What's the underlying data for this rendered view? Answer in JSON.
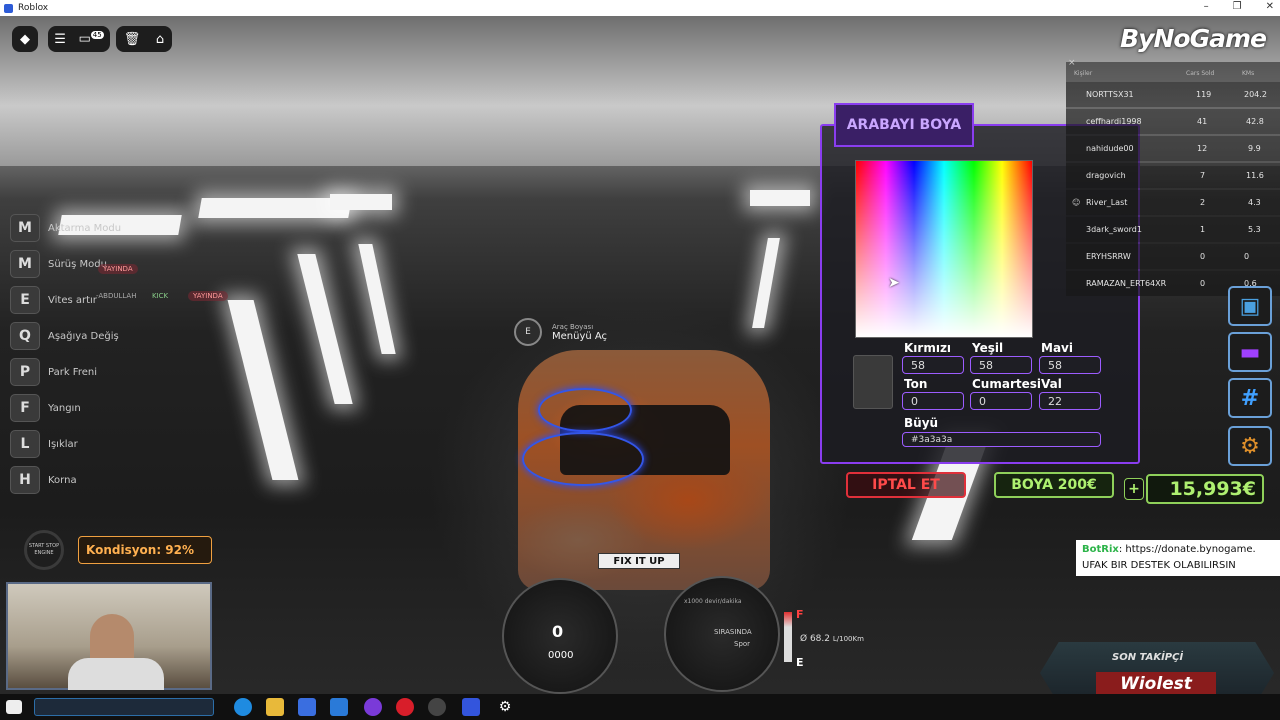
{
  "window": {
    "title": "Roblox"
  },
  "topbar": {
    "notification_count": "45"
  },
  "overlay": {
    "brand": "ByNoGame"
  },
  "keybinds": [
    {
      "key": "M",
      "label": "Aktarma Modu"
    },
    {
      "key": "M",
      "label": "Sürüş Modu"
    },
    {
      "key": "E",
      "label": "Vites artır"
    },
    {
      "key": "Q",
      "label": "Aşağıya Değiş"
    },
    {
      "key": "P",
      "label": "Park Freni"
    },
    {
      "key": "F",
      "label": "Yangın"
    },
    {
      "key": "L",
      "label": "Işıklar"
    },
    {
      "key": "H",
      "label": "Korna"
    }
  ],
  "chat_badges": {
    "stream_tag": "YAYINDA",
    "kick_user": "-ABDULLAH",
    "kick": "KICK"
  },
  "engine": {
    "button_label": "START STOP ENGINE"
  },
  "condition": {
    "label": "Kondisyon: 92%",
    "value": 92
  },
  "interaction": {
    "key": "E",
    "subtitle": "Araç Boyası",
    "action": "Menüyü Aç"
  },
  "car": {
    "plate": "FIX IT UP"
  },
  "dashboard": {
    "speed": "0",
    "odometer": "0000",
    "rpm_label": "x1000 devir/dakika",
    "mode_line1": "SIRASINDA",
    "mode_line2": "Spor",
    "fuel": "Ø 68.2",
    "fuel_unit": "L/100Km",
    "fuel_full": "F",
    "fuel_empty": "E"
  },
  "paint_dialog": {
    "title": "ARABAYI BOYA",
    "red_label": "Kırmızı",
    "red": "58",
    "green_label": "Yeşil",
    "green": "58",
    "blue_label": "Mavi",
    "blue": "58",
    "hue_label": "Ton",
    "hue": "0",
    "sat_label": "Cumartesi",
    "sat": "0",
    "val_label": "Val",
    "val": "22",
    "hex_label": "Büyü",
    "hex": "#3a3a3a",
    "swatch_color": "#3a3a3a",
    "cancel_label": "IPTAL ET",
    "paint_label": "BOYA 200€"
  },
  "wallet": {
    "add": "+",
    "balance": "15,993€"
  },
  "leaderboard": {
    "headers": [
      "Kişiler",
      "Cars Sold",
      "KMs"
    ],
    "rows": [
      {
        "name": "NORTTSX31",
        "sold": "119",
        "kms": "204.2"
      },
      {
        "name": "ceffhardi1998",
        "sold": "41",
        "kms": "42.8"
      },
      {
        "name": "nahidude00",
        "sold": "12",
        "kms": "9.9"
      },
      {
        "name": "dragovich",
        "sold": "7",
        "kms": "11.6"
      },
      {
        "name": "River_Last",
        "sold": "2",
        "kms": "4.3"
      },
      {
        "name": "3dark_sword1",
        "sold": "1",
        "kms": "5.3"
      },
      {
        "name": "ERYHSRRW",
        "sold": "0",
        "kms": "0"
      },
      {
        "name": "RAMAZAN_ERT64XR",
        "sold": "0",
        "kms": "0.6"
      }
    ]
  },
  "donation": {
    "bot": "BotRix",
    "text": ": https://donate.bynogame.",
    "line2": "UFAK BIR DESTEK OLABILIRSIN"
  },
  "last_follower": {
    "heading": "SON TAKİPÇİ",
    "name": "Wiolest"
  }
}
